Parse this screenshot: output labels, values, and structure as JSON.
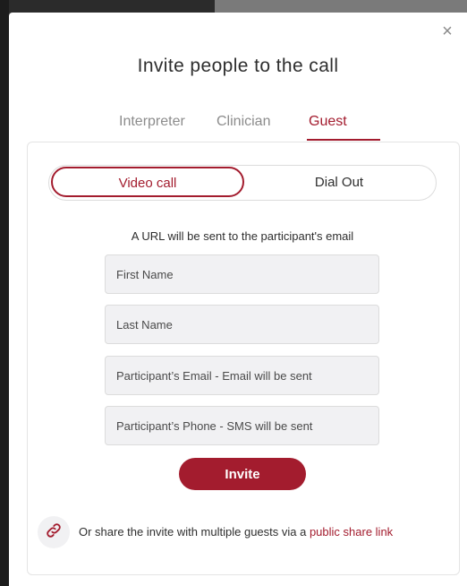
{
  "modal": {
    "title": "Invite people to the call",
    "close_glyph": "×"
  },
  "tabs": [
    {
      "label": "Interpreter",
      "active": false
    },
    {
      "label": "Clinician",
      "active": false
    },
    {
      "label": "Guest",
      "active": true
    }
  ],
  "call_type": {
    "options": [
      {
        "label": "Video call",
        "active": true
      },
      {
        "label": "Dial Out",
        "active": false
      }
    ]
  },
  "hint": "A URL will be sent to the participant's email",
  "form": {
    "first_name_placeholder": "First Name",
    "last_name_placeholder": "Last Name",
    "email_placeholder": "Participant’s Email - Email will be sent",
    "phone_placeholder": "Participant’s Phone - SMS will be sent",
    "invite_label": "Invite"
  },
  "share": {
    "text": "Or share the invite with multiple guests via a ",
    "link_label": "public share link",
    "icon": "link-icon"
  },
  "colors": {
    "accent": "#a31c2e",
    "field_bg": "#f1f1f3",
    "text": "#2e2e2e",
    "muted": "#8c8c8c"
  }
}
